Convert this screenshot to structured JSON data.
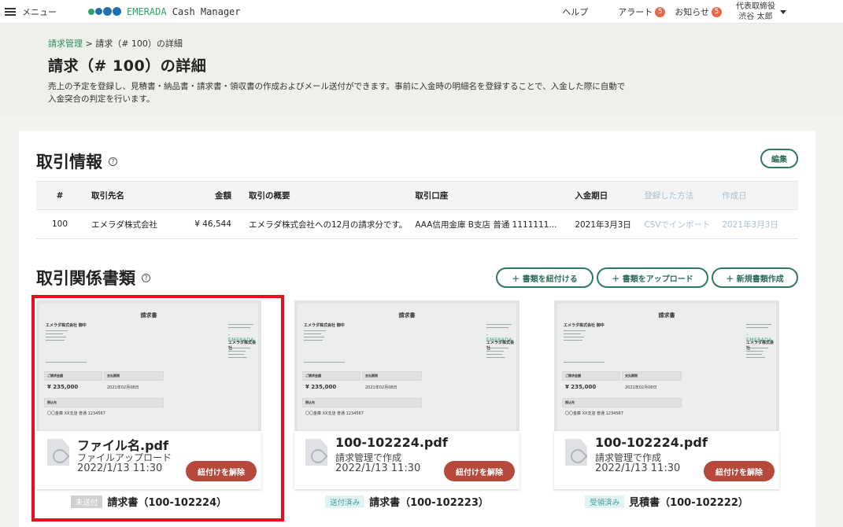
{
  "topbar": {
    "menu_label": "メニュー",
    "brand": "EMERADA",
    "app_name": " Cash Manager",
    "help": "ヘルプ",
    "alerts": "アラート",
    "alerts_count": "5",
    "notices": "お知らせ",
    "notices_count": "5",
    "user_role": "代表取締役",
    "user_name": "渋谷 太郎"
  },
  "header": {
    "breadcrumb_link": "請求管理",
    "breadcrumb_sep": " > ",
    "breadcrumb_current": "請求（# 100）の詳細",
    "title": "請求（# 100）の詳細",
    "desc_line1": "売上の予定を登録し、見積書・納品書・請求書・領収書の作成およびメール送付ができます。事前に入金時の明細名を登録することで、入金した際に自動で",
    "desc_line2": "入金突合の判定を行います。"
  },
  "deal": {
    "title": "取引情報",
    "help_icon": "?",
    "edit_label": "編集",
    "columns": [
      "#",
      "取引先名",
      "金額",
      "取引の概要",
      "取引口座",
      "入金期日",
      "登録した方法",
      "作成日"
    ],
    "row": {
      "id": "100",
      "client": "エメラダ株式会社",
      "amount": "¥ 46,544",
      "summary": "エメラダ株式会社への12月の請求分です。",
      "account": "AAA信用金庫 B支店 普通 1111111...",
      "due": "2021年3月3日",
      "method": "CSVでインポート",
      "created": "2021年3月3日"
    }
  },
  "docs_section": {
    "title": "取引関係書類",
    "help_icon": "?",
    "link_btn": "＋ 書類を紐付ける",
    "upload_btn": "＋ 書類をアップロード",
    "new_btn": "＋ 新規書類作成"
  },
  "preview": {
    "title": "請求書",
    "to": "エメラダ株式会社 御中",
    "emerada": "-EMERADA-",
    "company": "エメラダ株式会社",
    "amount_label": "ご請求金額",
    "amount": "¥ 235,000",
    "due_label": "支払期限",
    "due": "2021年02月08日",
    "bank_label": "振込先",
    "bank": "〇〇金庫 XX支店 普通 1234567"
  },
  "documents": [
    {
      "filename": "ファイル名.pdf",
      "sub": "ファイルアップロード",
      "date": "2022/1/13 11:30",
      "unlink": "紐付けを解除",
      "status": "未送付",
      "label": "請求書（100-102224）"
    },
    {
      "filename": "100-102224.pdf",
      "sub": "請求管理で作成",
      "date": "2022/1/13 11:30",
      "unlink": "紐付けを解除",
      "status": "送付済み",
      "label": "請求書（100-102223）"
    },
    {
      "filename": "100-102224.pdf",
      "sub": "請求管理で作成",
      "date": "2022/1/13 11:30",
      "unlink": "紐付けを解除",
      "status": "受領済み",
      "label": "見積書（100-102222）"
    }
  ],
  "colors": {
    "accent_green": "#2e7a5c",
    "unlink_red": "#b6483c",
    "highlight_red": "#e8101e",
    "badge_orange": "#e8674a"
  }
}
